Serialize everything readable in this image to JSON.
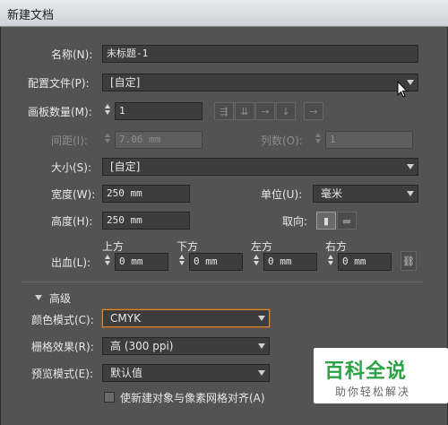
{
  "window": {
    "title": "新建文档"
  },
  "name": {
    "label": "名称(N):",
    "value": "未标题-1"
  },
  "profile": {
    "label": "配置文件(P):",
    "value": "[自定]"
  },
  "artboards": {
    "label": "画板数量(M):",
    "value": "1"
  },
  "spacing": {
    "label": "间距(I):",
    "value": "7.06 mm"
  },
  "columns": {
    "label": "列数(O):",
    "value": "1"
  },
  "size": {
    "label": "大小(S):",
    "value": "[自定]"
  },
  "width": {
    "label": "宽度(W):",
    "value": "250 mm"
  },
  "units": {
    "label": "单位(U):",
    "value": "毫米"
  },
  "height": {
    "label": "高度(H):",
    "value": "250 mm"
  },
  "orientation": {
    "label": "取向:"
  },
  "bleed": {
    "label": "出血(L):",
    "top_label": "上方",
    "top_value": "0 mm",
    "bottom_label": "下方",
    "bottom_value": "0 mm",
    "left_label": "左方",
    "left_value": "0 mm",
    "right_label": "右方",
    "right_value": "0 mm"
  },
  "advanced": {
    "label": "高级"
  },
  "color_mode": {
    "label": "颜色模式(C):",
    "value": "CMYK"
  },
  "raster": {
    "label": "栅格效果(R):",
    "value": "高 (300 ppi)"
  },
  "preview": {
    "label": "预览模式(E):",
    "value": "默认值"
  },
  "align_pixel": {
    "label": "使新建对象与像素网格对齐(A)"
  },
  "watermark": {
    "big": "百科全说",
    "small": "助你轻松解决"
  }
}
